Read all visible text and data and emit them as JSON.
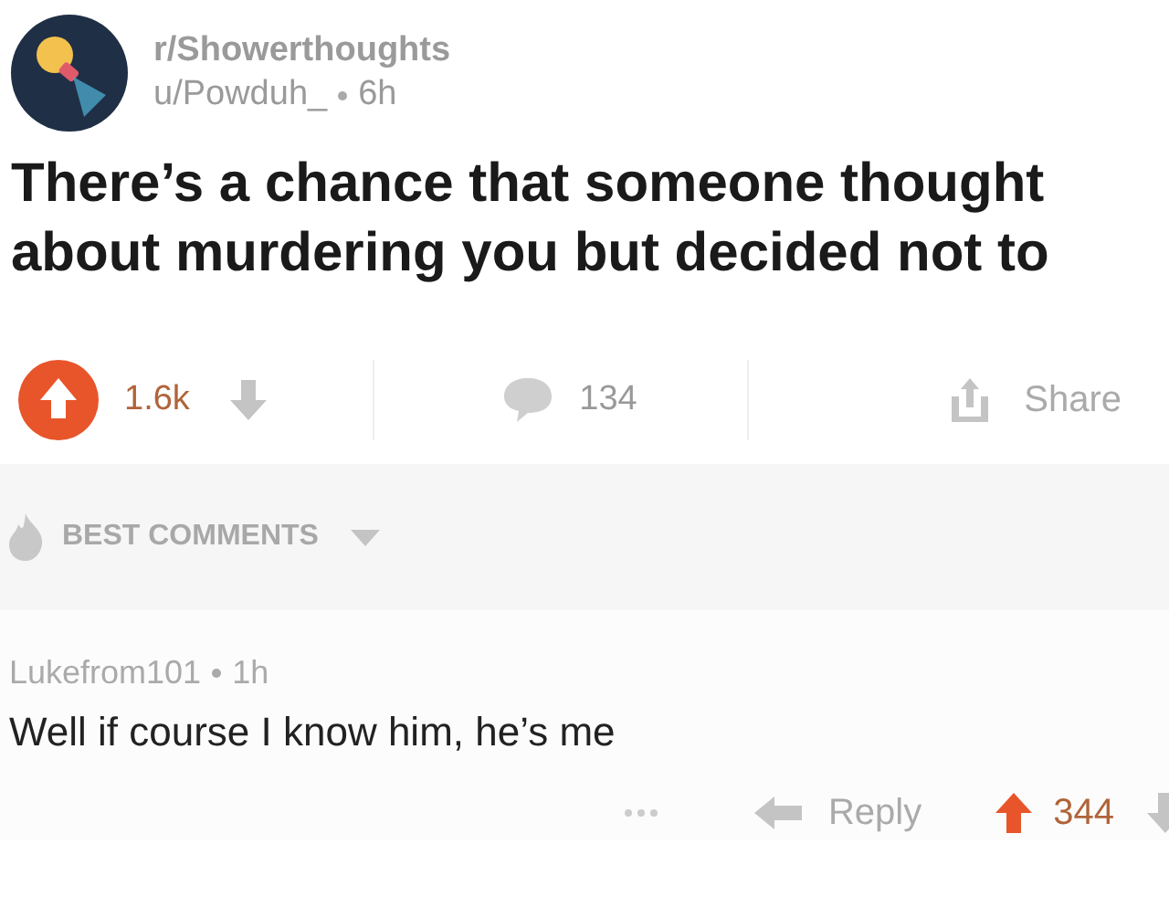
{
  "post": {
    "subreddit": "r/Showerthoughts",
    "author": "u/Powduh_",
    "age": "6h",
    "title": "There’s a chance that someone thought about murdering you but decided not to",
    "upvoted": true,
    "score": "1.6k",
    "comments": "134",
    "share": "Share"
  },
  "sort": {
    "label": "BEST COMMENTS"
  },
  "comments": [
    {
      "author": "Lukefrom101",
      "age": "1h",
      "body": "Well if course I know him, he’s me",
      "reply": "Reply",
      "upvoted": true,
      "score": "344"
    }
  ]
}
